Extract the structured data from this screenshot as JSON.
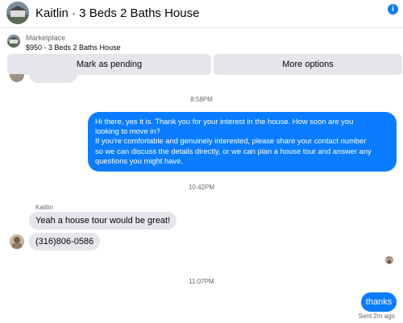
{
  "header": {
    "title": "Kaitlin · 3 Beds 2 Baths House",
    "info_icon": "i"
  },
  "listing": {
    "label": "Marketplace",
    "price_title": "$950 - 3 Beds 2 Baths House",
    "buttons": {
      "mark_pending": "Mark as pending",
      "more_options": "More options"
    }
  },
  "messages": {
    "timestamp_1": "8:58PM",
    "outgoing_1": {
      "lines": [
        "Hi there, yes it is. Thank you for your interest in the house. How soon are you",
        "looking to move in?",
        "If you're comfortable and genuinely interested, please share your contact number",
        "so we can discuss the details directly, or we can plan a house tour and answer any",
        "questions you might have."
      ]
    },
    "timestamp_2": "10:42PM",
    "sender_name": "Kaitlin",
    "incoming_1": "Yeah a house tour would be great!",
    "incoming_2": "(316)806-0586",
    "timestamp_3": "11:07PM",
    "outgoing_2": "thanks",
    "sent_status": "Sent 2m ago"
  },
  "colors": {
    "accent": "#0a7cff",
    "bubble_gray": "#e4e6eb",
    "muted_text": "#65676b"
  }
}
